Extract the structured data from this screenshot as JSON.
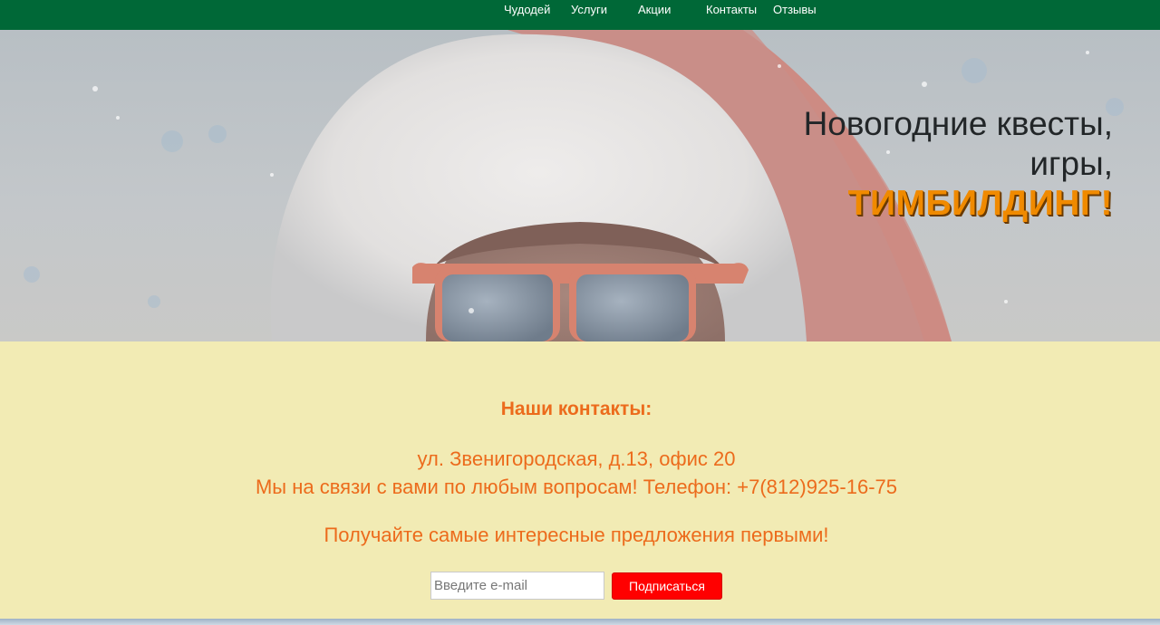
{
  "nav": {
    "items": [
      "Чудодей",
      "Услуги",
      "Акции",
      "Контакты",
      "Отзывы"
    ]
  },
  "hero": {
    "line1": "Новогодние квесты,",
    "line2": "игры,",
    "accent": "ТИМБИЛДИНГ!"
  },
  "contacts": {
    "title": "Наши контакты:",
    "address": "ул. Звенигородская, д.13, офис 20",
    "phone_line": "Мы на связи с вами по любым вопросам! Телефон: +7(812)925-16-75",
    "promo": "Получайте самые интересные предложения первыми!",
    "email_placeholder": "Введите e-mail",
    "subscribe_label": "Подписаться"
  },
  "colors": {
    "nav_bg": "#006837",
    "contacts_bg": "#f2ebb4",
    "accent_orange": "#ec6b1c",
    "button_red": "#ff0000"
  }
}
